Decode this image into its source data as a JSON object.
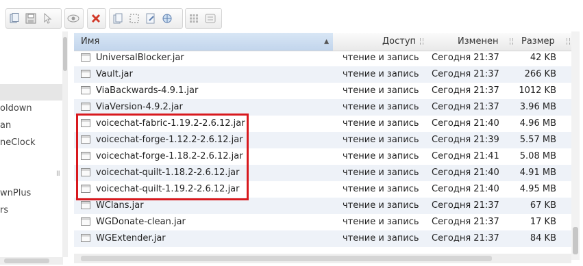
{
  "toolbar": {
    "buttons": [
      "copy-icon",
      "save-icon",
      "cursor-icon",
      "preview-icon",
      "delete-icon",
      "duplicate-icon",
      "select-icon",
      "edit-icon",
      "network-icon",
      "grid-view-icon",
      "list-view-icon"
    ]
  },
  "sidebar": {
    "items": [
      {
        "label": "oldown"
      },
      {
        "label": "an"
      },
      {
        "label": "neClock"
      },
      {
        "label": "wnPlus"
      },
      {
        "label": "rs"
      }
    ],
    "resize_glyph": "ll"
  },
  "columns": {
    "name": "Имя",
    "access": "Доступ",
    "modified": "Изменен",
    "size": "Размер"
  },
  "files": [
    {
      "name": "UniversalBlocker.jar",
      "access": "чтение и запись",
      "modified": "Сегодня 21:37",
      "size": "42 KB"
    },
    {
      "name": "Vault.jar",
      "access": "чтение и запись",
      "modified": "Сегодня 21:37",
      "size": "266 KB"
    },
    {
      "name": "ViaBackwards-4.9.1.jar",
      "access": "чтение и запись",
      "modified": "Сегодня 21:37",
      "size": "1012 KB"
    },
    {
      "name": "ViaVersion-4.9.2.jar",
      "access": "чтение и запись",
      "modified": "Сегодня 21:37",
      "size": "3.96 MB"
    },
    {
      "name": "voicechat-fabric-1.19.2-2.6.12.jar",
      "access": "чтение и запись",
      "modified": "Сегодня 21:40",
      "size": "4.96 MB"
    },
    {
      "name": "voicechat-forge-1.12.2-2.6.12.jar",
      "access": "чтение и запись",
      "modified": "Сегодня 21:39",
      "size": "5.57 MB"
    },
    {
      "name": "voicechat-forge-1.18.2-2.6.12.jar",
      "access": "чтение и запись",
      "modified": "Сегодня 21:41",
      "size": "5.08 MB"
    },
    {
      "name": "voicechat-quilt-1.18.2-2.6.12.jar",
      "access": "чтение и запись",
      "modified": "Сегодня 21:40",
      "size": "4.91 MB"
    },
    {
      "name": "voicechat-quilt-1.19.2-2.6.12.jar",
      "access": "чтение и запись",
      "modified": "Сегодня 21:40",
      "size": "4.95 MB"
    },
    {
      "name": "WClans.jar",
      "access": "чтение и запись",
      "modified": "Сегодня 21:37",
      "size": "67 KB"
    },
    {
      "name": "WGDonate-clean.jar",
      "access": "чтение и запись",
      "modified": "Сегодня 21:37",
      "size": "17 KB"
    },
    {
      "name": "WGExtender.jar",
      "access": "чтение и запись",
      "modified": "Сегодня 21:37",
      "size": "84 KB"
    }
  ],
  "colors": {
    "highlight_box": "#d8191e",
    "header_active": "#c2d5ec",
    "row_alt": "#eef2f8"
  }
}
